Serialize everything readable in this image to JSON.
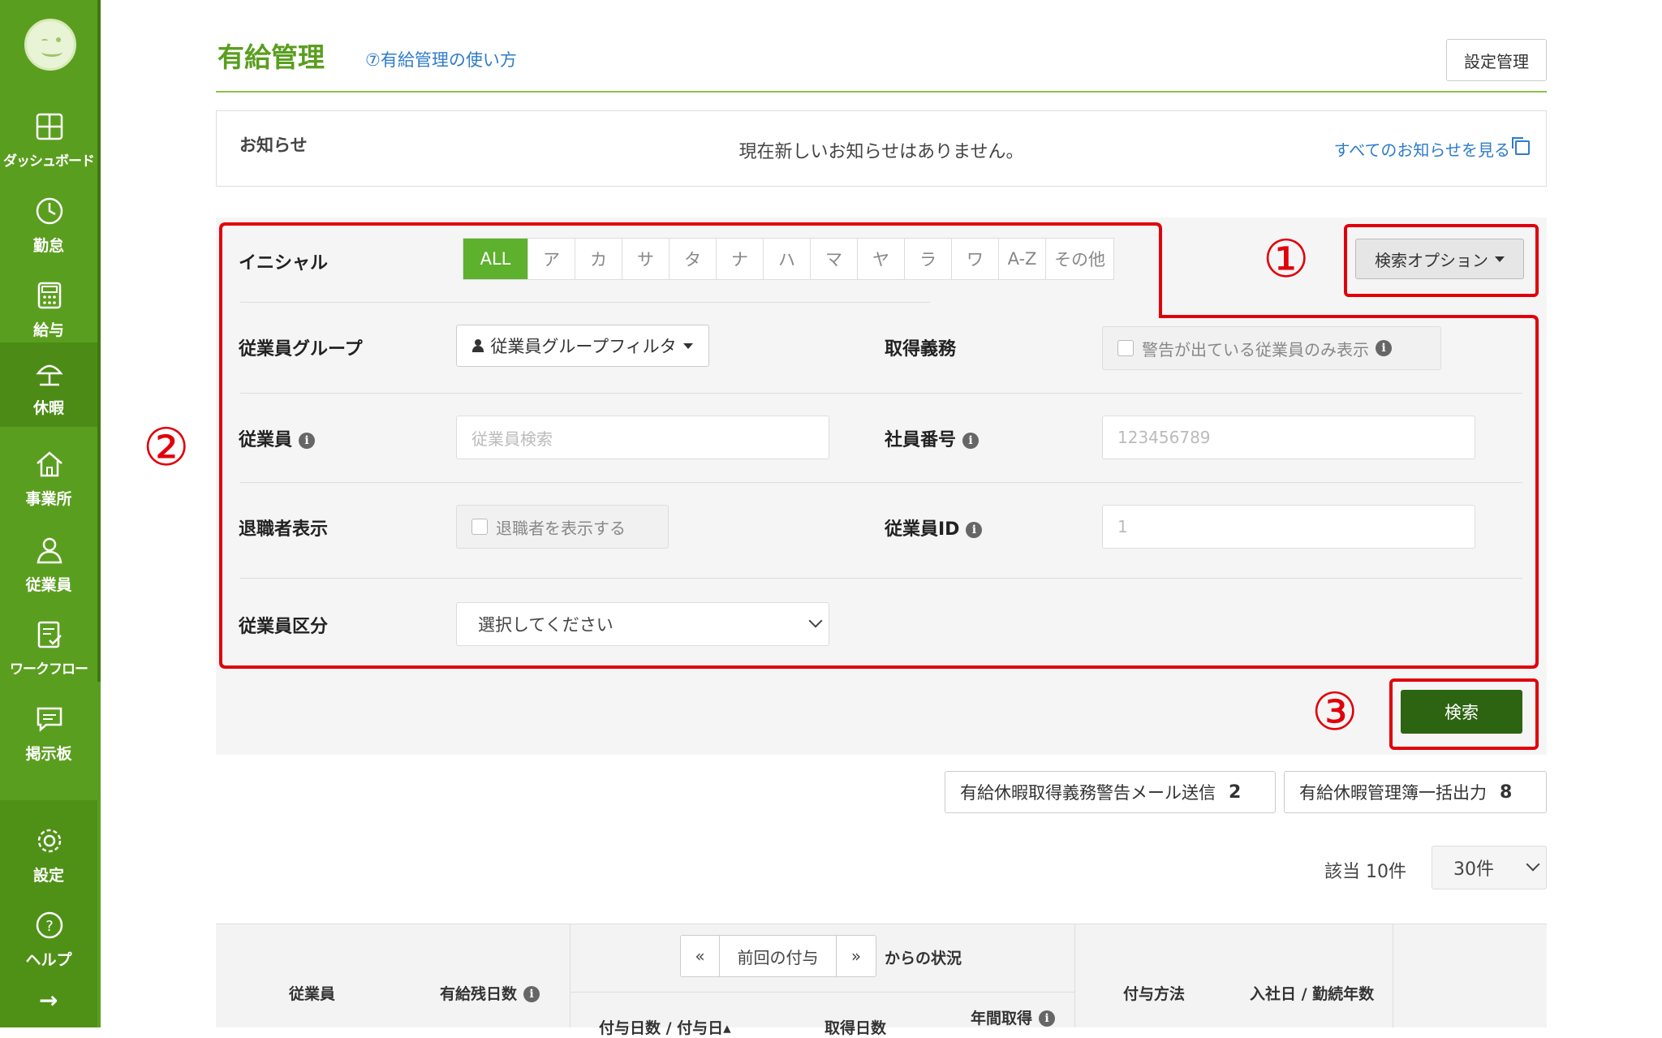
{
  "sidebar": {
    "items": [
      {
        "label": "ダッシュボード",
        "icon": "dashboard-icon"
      },
      {
        "label": "勤怠",
        "icon": "clock-icon"
      },
      {
        "label": "給与",
        "icon": "calculator-icon"
      },
      {
        "label": "休暇",
        "icon": "umbrella-icon"
      },
      {
        "label": "事業所",
        "icon": "home-icon"
      },
      {
        "label": "従業員",
        "icon": "person-icon"
      },
      {
        "label": "ワークフロー",
        "icon": "workflow-icon"
      },
      {
        "label": "掲示板",
        "icon": "message-icon"
      },
      {
        "label": "設定",
        "icon": "gear-icon"
      },
      {
        "label": "ヘルプ",
        "icon": "help-icon"
      }
    ],
    "expand": "→"
  },
  "header": {
    "title": "有給管理",
    "help_link": "⑦有給管理の使い方",
    "settings_button": "設定管理"
  },
  "notice": {
    "label": "お知らせ",
    "message": "現在新しいお知らせはありません。",
    "all_link": "すべてのお知らせを見る"
  },
  "search": {
    "initial_label": "イニシャル",
    "initials": [
      "ALL",
      "ア",
      "カ",
      "サ",
      "タ",
      "ナ",
      "ハ",
      "マ",
      "ヤ",
      "ラ",
      "ワ",
      "A-Z",
      "その他"
    ],
    "options_button": "検索オプション",
    "group_label": "従業員グループ",
    "group_button": "従業員グループフィルタ",
    "obligation_label": "取得義務",
    "obligation_checkbox": "警告が出ている従業員のみ表示",
    "employee_label": "従業員",
    "employee_placeholder": "従業員検索",
    "staff_no_label": "社員番号",
    "staff_no_placeholder": "123456789",
    "retired_label": "退職者表示",
    "retired_checkbox": "退職者を表示する",
    "employee_id_label": "従業員ID",
    "employee_id_placeholder": "1",
    "category_label": "従業員区分",
    "category_value": "選択してください",
    "search_button": "検索"
  },
  "annotations": {
    "m1": "①",
    "m2": "②",
    "m3": "③"
  },
  "actions": {
    "warning_mail": {
      "label": "有給休暇取得義務警告メール送信",
      "count": "2"
    },
    "bulk_export": {
      "label": "有給休暇管理簿一括出力",
      "count": "8"
    }
  },
  "results": {
    "count_text": "該当 10件",
    "per_page": "30件"
  },
  "table": {
    "employee": "従業員",
    "remaining": "有給残日数",
    "pager_prev": "«",
    "pager_label": "前回の付与",
    "pager_next": "»",
    "status_suffix": "からの状況",
    "grant_method": "付与方法",
    "join_date": "入社日 / 勤続年数",
    "grant_days": "付与日数 / 付与日▴",
    "taken_days": "取得日数",
    "annual": "年間取得"
  },
  "colors": {
    "brand": "#5a9e1f",
    "accent_red": "#e0000b",
    "search_button": "#2d6412",
    "link": "#2f7cc9"
  }
}
